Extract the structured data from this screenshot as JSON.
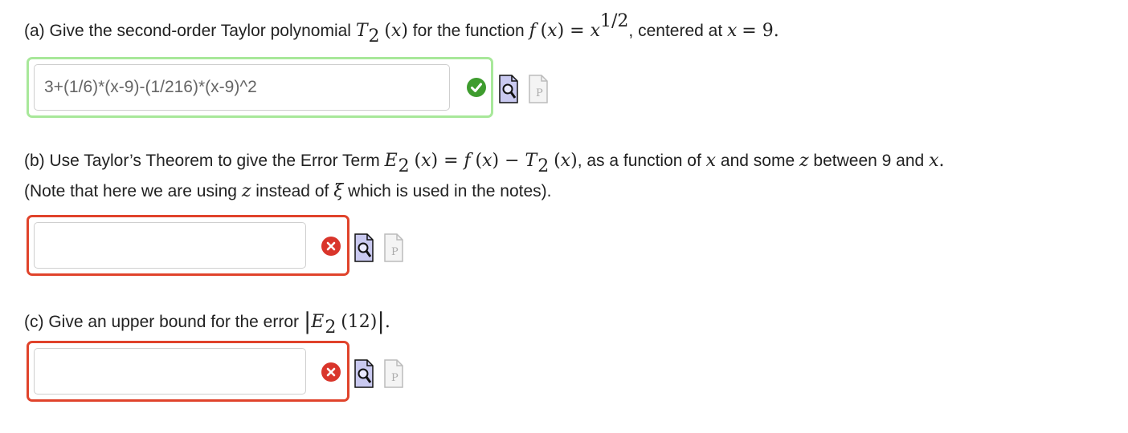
{
  "parts": {
    "a": {
      "prefix": "(a) Give the second-order Taylor polynomial",
      "mid": "for the function",
      "suffix": ", centered at",
      "answer_value": "3+(1/6)*(x-9)-(1/216)*(x-9)^2",
      "status": "correct"
    },
    "b": {
      "prefix": "(b) Use Taylor’s Theorem to give the Error Term",
      "mid1": ", as a function of",
      "mid2": "and some",
      "mid3": "between 9 and",
      "line2_prefix": "(Note that here we are using",
      "line2_mid": "instead of",
      "line2_suffix": "which is used in the notes).",
      "answer_value": "",
      "status": "incorrect"
    },
    "c": {
      "prefix": "(c) Give an upper bound for the error",
      "answer_value": "",
      "status": "incorrect"
    }
  },
  "icons": [
    "preview-icon",
    "preview-expression-icon"
  ],
  "colors": {
    "correct_border": "#a8e89a",
    "incorrect_border": "#e0432b",
    "correct_badge": "#3e9c2e",
    "incorrect_badge": "#d9352b"
  }
}
